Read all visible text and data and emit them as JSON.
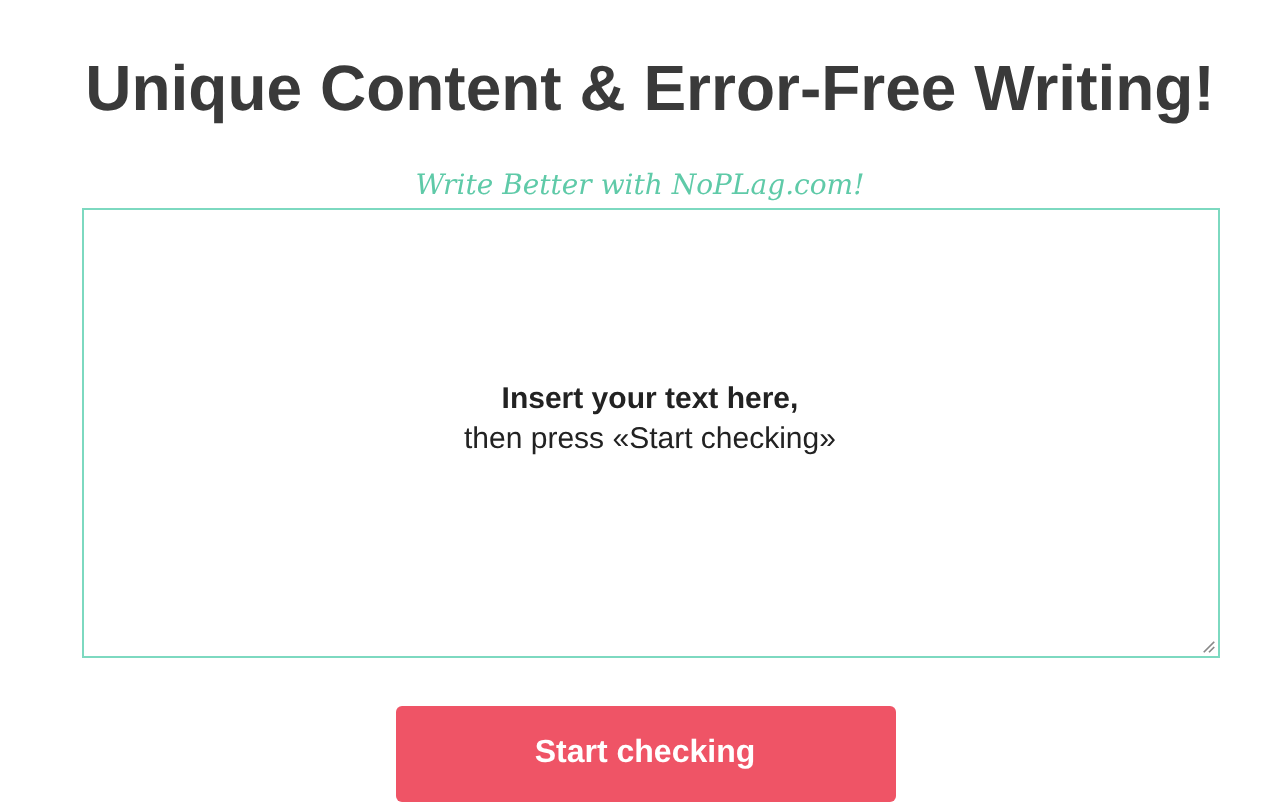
{
  "heading": "Unique Content & Error-Free Writing!",
  "tagline": "Write Better with NoPLag.com!",
  "text_area": {
    "placeholder": "**Insert your text here,**\nthen press «Start checking»"
  },
  "button": "Start checking"
}
